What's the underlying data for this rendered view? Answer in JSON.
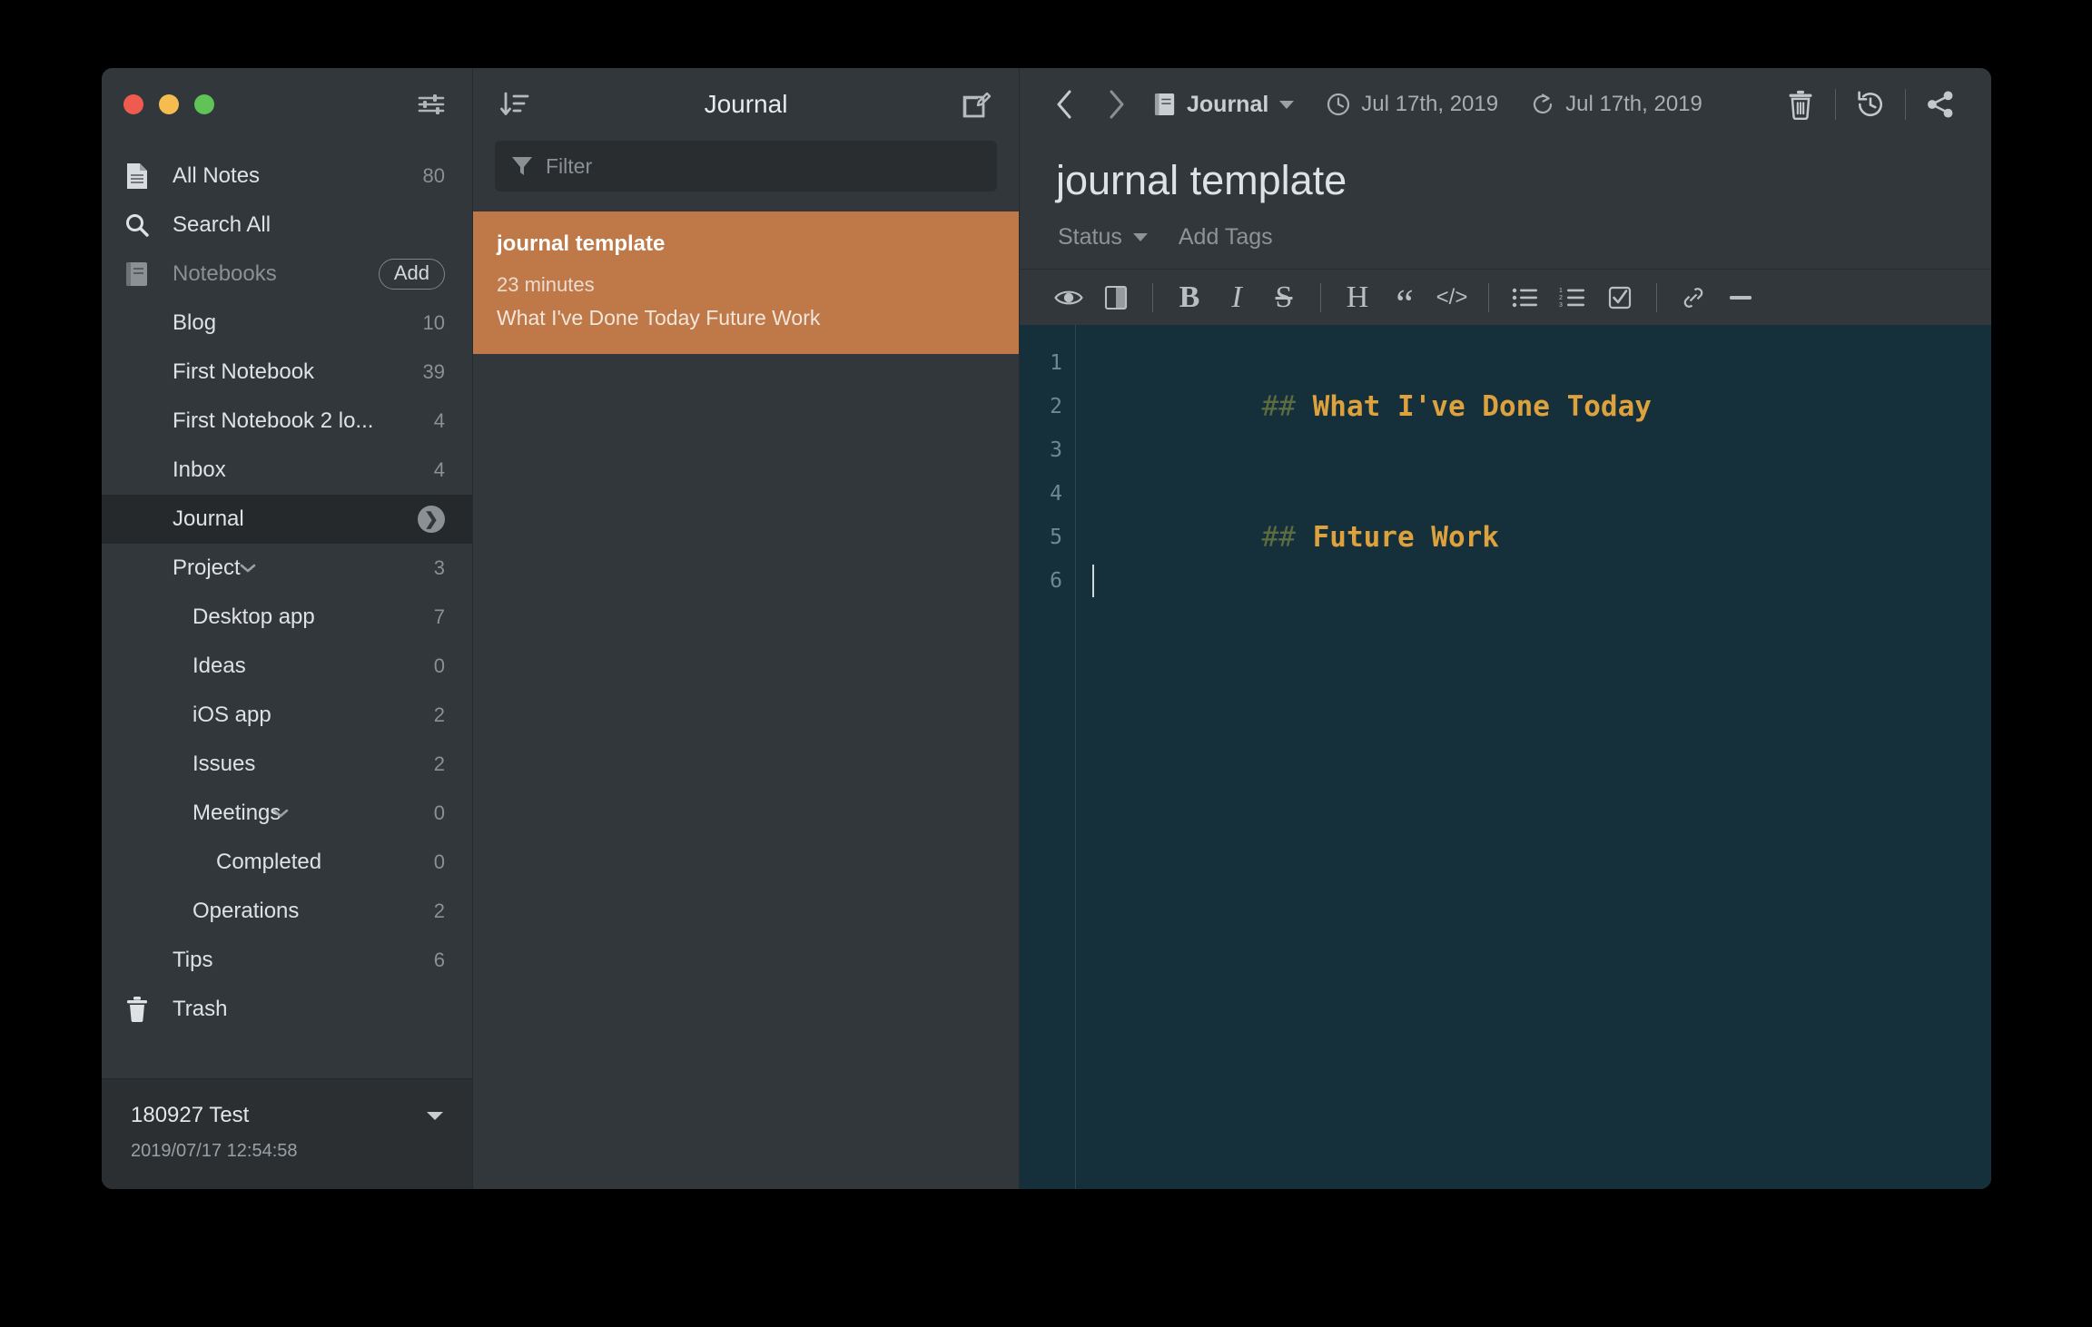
{
  "window": {
    "traffic_lights": [
      "close",
      "minimize",
      "maximize"
    ],
    "accent_color": "#bf7948",
    "sidebar_bg": "#32373b",
    "editor_bg": "#15303a"
  },
  "sidebar": {
    "settings_icon": "sliders-icon",
    "top_items": [
      {
        "label": "All Notes",
        "count": "80",
        "icon": "document-icon"
      },
      {
        "label": "Search All",
        "count": "",
        "icon": "search-icon"
      }
    ],
    "notebooks_header": {
      "label": "Notebooks",
      "icon": "notebook-icon",
      "add_label": "Add"
    },
    "notebooks": [
      {
        "label": "Blog",
        "count": "10",
        "indent": 1,
        "chevron": "",
        "selected": false
      },
      {
        "label": "First Notebook",
        "count": "39",
        "indent": 1,
        "chevron": "",
        "selected": false
      },
      {
        "label": "First Notebook 2 lo...",
        "count": "4",
        "indent": 1,
        "chevron": "",
        "selected": false
      },
      {
        "label": "Inbox",
        "count": "4",
        "indent": 1,
        "chevron": "",
        "selected": false
      },
      {
        "label": "Journal",
        "count": "",
        "indent": 1,
        "chevron": "",
        "selected": true
      },
      {
        "label": "Project",
        "count": "3",
        "indent": 1,
        "chevron": "down",
        "selected": false
      },
      {
        "label": "Desktop app",
        "count": "7",
        "indent": 2,
        "chevron": "",
        "selected": false
      },
      {
        "label": "Ideas",
        "count": "0",
        "indent": 2,
        "chevron": "",
        "selected": false
      },
      {
        "label": "iOS app",
        "count": "2",
        "indent": 2,
        "chevron": "",
        "selected": false
      },
      {
        "label": "Issues",
        "count": "2",
        "indent": 2,
        "chevron": "",
        "selected": false
      },
      {
        "label": "Meetings",
        "count": "0",
        "indent": 2,
        "chevron": "down",
        "selected": false
      },
      {
        "label": "Completed",
        "count": "0",
        "indent": 3,
        "chevron": "",
        "selected": false
      },
      {
        "label": "Operations",
        "count": "2",
        "indent": 2,
        "chevron": "",
        "selected": false
      },
      {
        "label": "Tips",
        "count": "6",
        "indent": 1,
        "chevron": "",
        "selected": false
      }
    ],
    "trash": {
      "label": "Trash",
      "icon": "trash-icon"
    },
    "storage": {
      "name": "180927 Test",
      "date": "2019/07/17 12:54:58",
      "caret": "chevron-down-icon"
    }
  },
  "notelist": {
    "sort_icon": "sort-descending-icon",
    "title": "Journal",
    "new_note_icon": "compose-icon",
    "filter": {
      "placeholder": "Filter",
      "value": "",
      "icon": "funnel-icon"
    },
    "notes": [
      {
        "title": "journal template",
        "meta": "23 minutes",
        "preview": "What I've Done Today Future Work",
        "selected": true
      }
    ]
  },
  "editor": {
    "nav": {
      "back_icon": "chevron-left-icon",
      "forward_icon": "chevron-right-icon"
    },
    "notebook": {
      "icon": "notebook-icon",
      "label": "Journal",
      "caret": "chevron-down-icon"
    },
    "created": {
      "icon": "clock-icon",
      "text": "Jul 17th, 2019"
    },
    "updated": {
      "icon": "refresh-icon",
      "text": "Jul 17th, 2019"
    },
    "actions": [
      {
        "name": "delete",
        "icon": "trash-icon"
      },
      {
        "name": "history",
        "icon": "history-icon"
      },
      {
        "name": "share",
        "icon": "share-icon"
      }
    ],
    "title": "journal template",
    "status": {
      "label": "Status",
      "caret": "chevron-down-icon"
    },
    "add_tags": "Add Tags",
    "md_toolbar": [
      {
        "name": "preview",
        "icon": "eye-icon",
        "glyph": ""
      },
      {
        "name": "split-view",
        "icon": "split-view-icon",
        "glyph": ""
      },
      {
        "name": "separator",
        "icon": "",
        "glyph": ""
      },
      {
        "name": "bold",
        "icon": "bold-icon",
        "glyph": "B"
      },
      {
        "name": "italic",
        "icon": "italic-icon",
        "glyph": "I"
      },
      {
        "name": "strikethrough",
        "icon": "strikethrough-icon",
        "glyph": "S"
      },
      {
        "name": "separator",
        "icon": "",
        "glyph": ""
      },
      {
        "name": "heading",
        "icon": "heading-icon",
        "glyph": "H"
      },
      {
        "name": "quote",
        "icon": "quote-icon",
        "glyph": "“"
      },
      {
        "name": "code",
        "icon": "code-icon",
        "glyph": "</>"
      },
      {
        "name": "separator",
        "icon": "",
        "glyph": ""
      },
      {
        "name": "bullet-list",
        "icon": "bullet-list-icon",
        "glyph": ""
      },
      {
        "name": "numbered-list",
        "icon": "numbered-list-icon",
        "glyph": ""
      },
      {
        "name": "checklist",
        "icon": "checklist-icon",
        "glyph": ""
      },
      {
        "name": "separator",
        "icon": "",
        "glyph": ""
      },
      {
        "name": "link",
        "icon": "link-icon",
        "glyph": ""
      },
      {
        "name": "horizontal-rule",
        "icon": "horizontal-rule-icon",
        "glyph": ""
      }
    ],
    "code": {
      "line_numbers": [
        "1",
        "2",
        "3",
        "4",
        "5",
        "6"
      ],
      "lines": [
        {
          "prefix": "## ",
          "text": "What I've Done Today"
        },
        {
          "prefix": "",
          "text": ""
        },
        {
          "prefix": "",
          "text": ""
        },
        {
          "prefix": "## ",
          "text": "Future Work"
        },
        {
          "prefix": "",
          "text": ""
        },
        {
          "prefix": "",
          "text": "",
          "cursor": true
        }
      ],
      "heading_color": "#dda23e",
      "hash_color": "#5d6d41"
    }
  }
}
